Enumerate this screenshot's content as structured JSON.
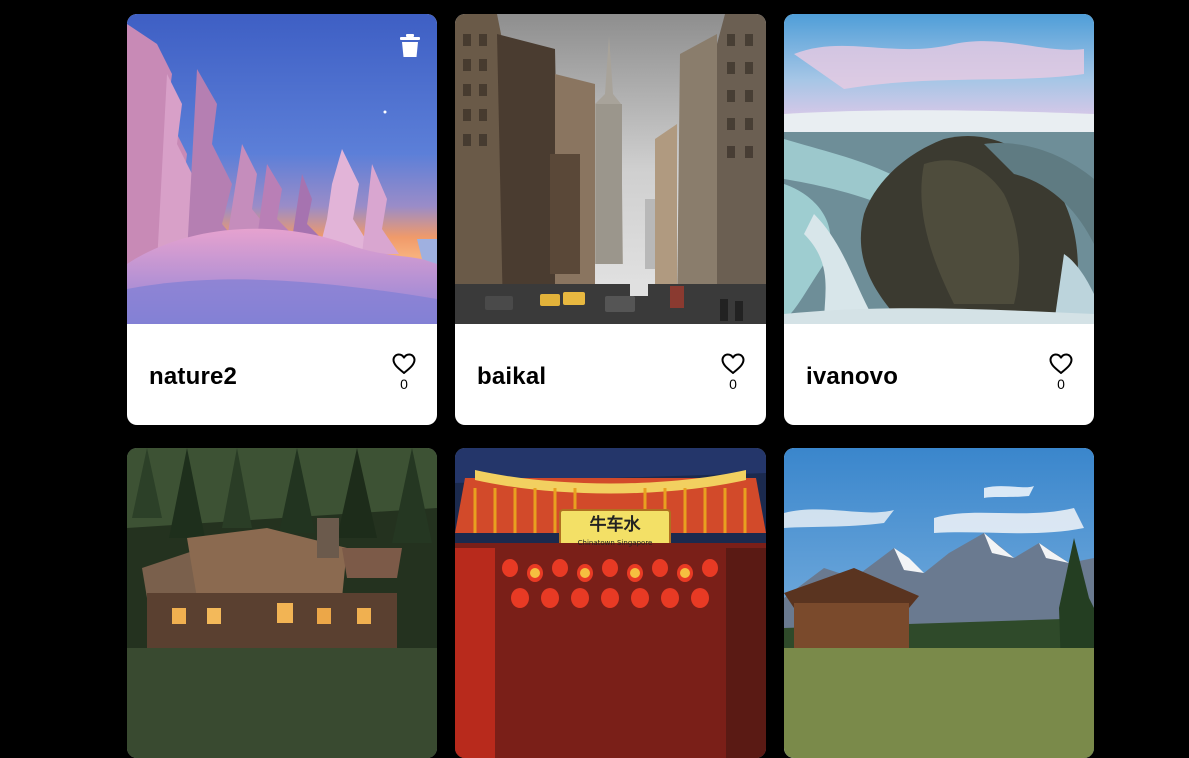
{
  "cards": [
    {
      "title": "nature2",
      "likes": "0",
      "can_delete": true,
      "photo": "winter-forest-sunset"
    },
    {
      "title": "baikal",
      "likes": "0",
      "can_delete": false,
      "photo": "city-street-skyscraper"
    },
    {
      "title": "ivanovo",
      "likes": "0",
      "can_delete": false,
      "photo": "mountain-river-cliff"
    },
    {
      "photo": "log-cabin-forest"
    },
    {
      "photo": "chinatown-gate-lanterns",
      "sign_text": "牛车水",
      "sign_subtext": "Chinatown Singapore"
    },
    {
      "photo": "barn-mountains"
    }
  ],
  "icons": {
    "delete": "trash-icon",
    "like": "heart-outline-icon"
  },
  "colors": {
    "page_background": "#000000",
    "card_background": "#ffffff",
    "text": "#000000"
  }
}
